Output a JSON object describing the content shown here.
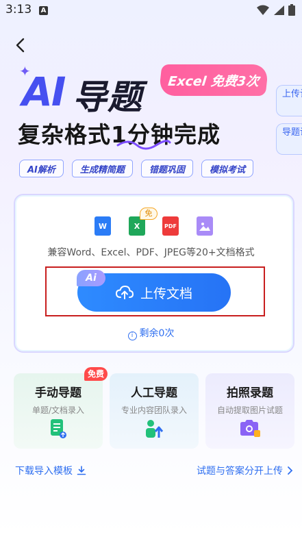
{
  "status_bar": {
    "time": "3:13",
    "notif_letter": "A"
  },
  "hero": {
    "ai_text": "AI",
    "title_rest": "导题",
    "badge": "Excel 免费3次",
    "subtitle": "复杂格式1分钟完成"
  },
  "tags": [
    "AI解析",
    "生成精简题",
    "错题巩固",
    "模拟考试"
  ],
  "side_tabs": [
    {
      "label": "上传记录"
    },
    {
      "label": "导题说明"
    }
  ],
  "upload": {
    "file_icons": [
      {
        "label": "W",
        "color": "#2b7cf6"
      },
      {
        "label": "X",
        "color": "#1fa75a"
      },
      {
        "label": "PDF",
        "color": "#ee3b3b"
      },
      {
        "label": "",
        "color": "#a98bf7"
      }
    ],
    "free_tag": "免",
    "formats_text": "兼容Word、Excel、PDF、JPEG等20+文档格式",
    "ai_chip": "Ai",
    "button_label": "上传文档",
    "remaining": "剩余0次"
  },
  "modes": [
    {
      "title": "手动导题",
      "subtitle": "单题/文档录入",
      "color": "#e9f6ef"
    },
    {
      "title": "人工导题",
      "subtitle": "专业内容团队录入",
      "color": "#e8f3fb"
    },
    {
      "title": "拍照录题",
      "subtitle": "自动提取图片试题",
      "color": "#efeefe"
    }
  ],
  "free_badge": "免费",
  "links": {
    "download_template": "下载导入模板",
    "separate_upload": "试题与答案分开上传"
  }
}
